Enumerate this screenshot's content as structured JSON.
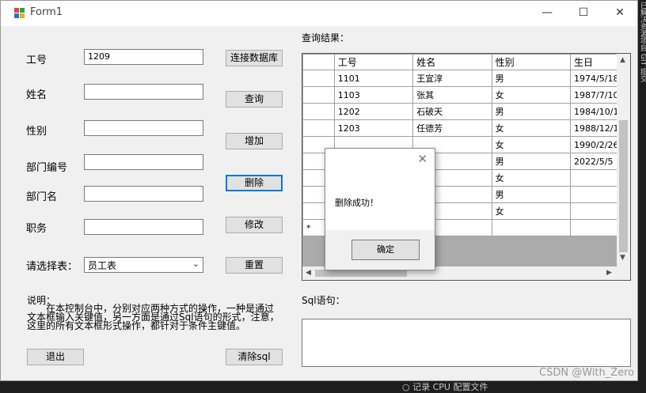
{
  "window": {
    "title": "Form1"
  },
  "titlebar": {
    "minimize_glyph": "—",
    "maximize_glyph": "☐",
    "close_glyph": "✕"
  },
  "form": {
    "fields": [
      {
        "label": "工号",
        "value": "1209"
      },
      {
        "label": "姓名",
        "value": ""
      },
      {
        "label": "性别",
        "value": ""
      },
      {
        "label": "部门编号",
        "value": ""
      },
      {
        "label": "部门名",
        "value": ""
      },
      {
        "label": "职务",
        "value": ""
      }
    ],
    "select_label": "请选择表：",
    "select_value": "员工表",
    "description_label": "说明：",
    "description_text": "在本控制台中，分别对应两种方式的操作，一种是通过文本框输入关键值，另一方面是通过Sql语句的形式，注意，这里的所有文本框形式操作，都针对于条件主键值。"
  },
  "buttons": {
    "connect": "连接数据库",
    "query": "查询",
    "add": "增加",
    "delete": "删除",
    "modify": "修改",
    "reset": "重置",
    "exit": "退出",
    "clear_sql": "清除sql"
  },
  "results": {
    "label": "查询结果：",
    "columns": [
      "工号",
      "姓名",
      "性别",
      "生日"
    ],
    "rows": [
      [
        "1101",
        "王宜淳",
        "男",
        "1974/5/18"
      ],
      [
        "1103",
        "张其",
        "女",
        "1987/7/10"
      ],
      [
        "1202",
        "石破天",
        "男",
        "1984/10/1"
      ],
      [
        "1203",
        "任德芳",
        "女",
        "1988/12/1"
      ],
      [
        "",
        "",
        "女",
        "1990/2/26"
      ],
      [
        "",
        "",
        "男",
        "2022/5/5"
      ],
      [
        "",
        "",
        "女",
        ""
      ],
      [
        "",
        "",
        "男",
        ""
      ],
      [
        "",
        "",
        "女",
        ""
      ]
    ],
    "new_row_marker": "*"
  },
  "sql": {
    "label": "Sql语句：",
    "value": ""
  },
  "dialog": {
    "message": "删除成功！",
    "ok_label": "确定",
    "close_glyph": "✕"
  },
  "background": {
    "bottom_text": "记录 CPU 配置文件",
    "watermark": "CSDN @With_Zero",
    "side_text": "已解决资源项目 GIT 提交"
  },
  "colors": {
    "focus_border": "#0078d7",
    "grid_background": "#ababab"
  }
}
